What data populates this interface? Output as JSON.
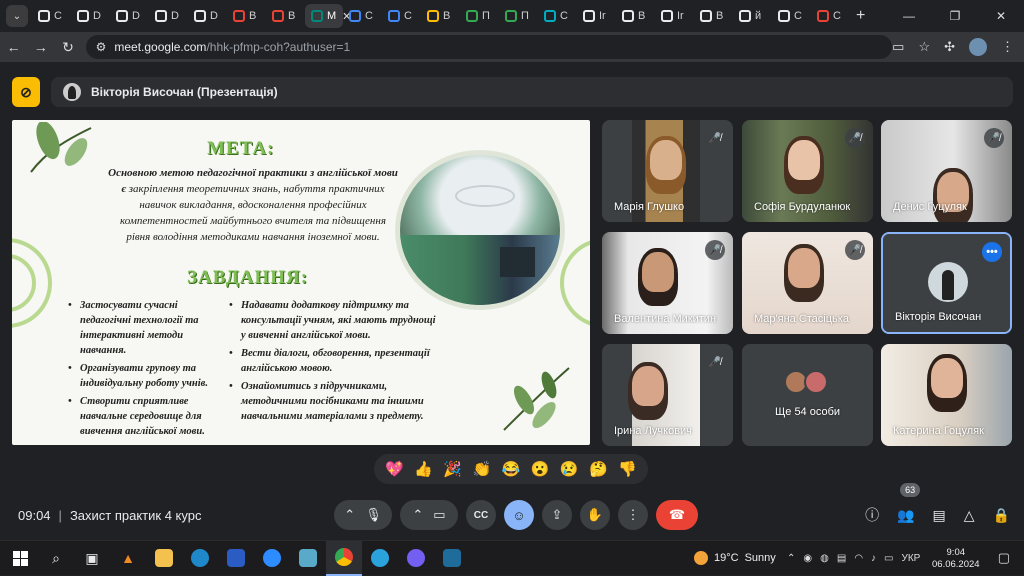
{
  "browser": {
    "tabs": [
      {
        "label": "C",
        "color": "#e8eaed"
      },
      {
        "label": "D",
        "color": "#e8eaed"
      },
      {
        "label": "D",
        "color": "#e8eaed"
      },
      {
        "label": "D",
        "color": "#e8eaed"
      },
      {
        "label": "D",
        "color": "#e8eaed"
      },
      {
        "label": "B",
        "color": "#ea4335"
      },
      {
        "label": "B",
        "color": "#ea4335"
      },
      {
        "label": "M",
        "color": "#00897b",
        "active": true
      },
      {
        "label": "C",
        "color": "#4285f4"
      },
      {
        "label": "C",
        "color": "#4285f4"
      },
      {
        "label": "B",
        "color": "#fbbc04"
      },
      {
        "label": "П",
        "color": "#34a853"
      },
      {
        "label": "П",
        "color": "#34a853"
      },
      {
        "label": "C",
        "color": "#00acc1"
      },
      {
        "label": "Ir",
        "color": "#e8eaed"
      },
      {
        "label": "B",
        "color": "#e8eaed"
      },
      {
        "label": "Ir",
        "color": "#e8eaed"
      },
      {
        "label": "B",
        "color": "#e8eaed"
      },
      {
        "label": "й",
        "color": "#e8eaed"
      },
      {
        "label": "C",
        "color": "#e8eaed"
      },
      {
        "label": "C",
        "color": "#ea4335"
      }
    ],
    "close_glyph": "✕",
    "new_tab": "+",
    "url_host": "meet.google.com",
    "url_path": "/hhk-pfmp-coh?authuser=1"
  },
  "presentation": {
    "presenter": "Вікторія Височан (Презентація)"
  },
  "slide": {
    "goal_title": "МЕТА:",
    "goal_text_bold": "Основною метою педагогічної практики з англійської мови є",
    "goal_text": "закріплення теоретичних знань, набуття практичних навичок викладання, вдосконалення професійних компетентностей майбутнього вчителя та підвищення рівня володіння методиками навчання іноземної мови.",
    "tasks_title": "ЗАВДАННЯ:",
    "tasks_left": [
      "Застосувати сучасні педагогічні технології та інтерактивні методи навчання.",
      "Організувати групову та індивідуальну роботу учнів.",
      "Створити сприятливе навчальне середовище для вивчення англійської мови."
    ],
    "tasks_right": [
      "Надавати додаткову підтримку та консультації учням, які мають труднощі у вивченні англійської мови.",
      "Вести діалоги, обговорення, презентації англійською мовою.",
      "Ознайомитись з підручниками, методичними посібниками та іншими навчальними матеріалами з предмету."
    ]
  },
  "participants": [
    {
      "name": "Марія Глушко",
      "muted": true
    },
    {
      "name": "Софія Бурдуланюк",
      "muted": true
    },
    {
      "name": "Денис Гуцуляк",
      "muted": true
    },
    {
      "name": "Валентина Микитин",
      "muted": true
    },
    {
      "name": "Мар'яна Стасіцька",
      "muted": true
    },
    {
      "name": "Вікторія Височан",
      "muted": false,
      "more": "•••"
    },
    {
      "name": "Ірина Лучкович",
      "muted": true
    },
    {
      "name": "Ще 54 особи",
      "muted": false
    },
    {
      "name": "Катерина Гоцуляк",
      "muted": false
    }
  ],
  "reactions": [
    "💖",
    "👍",
    "🎉",
    "👏",
    "😂",
    "😮",
    "😢",
    "🤔",
    "👎"
  ],
  "meeting": {
    "time": "09:04",
    "separator": "|",
    "title": "Захист практик 4 курс",
    "people_count": "63"
  },
  "taskbar": {
    "weather_temp": "19°C",
    "weather_desc": "Sunny",
    "lang": "УКР",
    "clock_time": "9:04",
    "clock_date": "06.06.2024"
  }
}
